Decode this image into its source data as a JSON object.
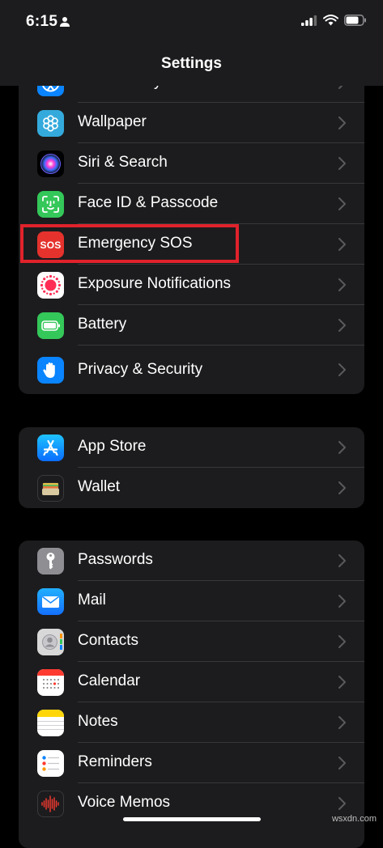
{
  "status_bar": {
    "time": "6:15"
  },
  "nav": {
    "title": "Settings"
  },
  "groups": [
    {
      "items": [
        {
          "label": "Accessibility",
          "icon": "accessibility-icon",
          "color": "#0a84ff"
        },
        {
          "label": "Wallpaper",
          "icon": "wallpaper-icon",
          "color": "#34aadc"
        },
        {
          "label": "Siri & Search",
          "icon": "siri-icon",
          "color": "#000000"
        },
        {
          "label": "Face ID & Passcode",
          "icon": "face-id-icon",
          "color": "#34c759"
        },
        {
          "label": "Emergency SOS",
          "icon": "sos-icon",
          "color": "#e5322d",
          "icon_text": "SOS",
          "highlighted": true
        },
        {
          "label": "Exposure Notifications",
          "icon": "exposure-notifications-icon",
          "color": "#ffffff"
        },
        {
          "label": "Battery",
          "icon": "battery-icon",
          "color": "#34c759"
        },
        {
          "label": "Privacy & Security",
          "icon": "privacy-hand-icon",
          "color": "#0a84ff"
        }
      ]
    },
    {
      "items": [
        {
          "label": "App Store",
          "icon": "app-store-icon",
          "color": "#1a8cff"
        },
        {
          "label": "Wallet",
          "icon": "wallet-icon",
          "color": "#1c1c1e"
        }
      ]
    },
    {
      "items": [
        {
          "label": "Passwords",
          "icon": "key-icon",
          "color": "#8e8e93"
        },
        {
          "label": "Mail",
          "icon": "mail-icon",
          "color": "#1a8cff"
        },
        {
          "label": "Contacts",
          "icon": "contacts-icon",
          "color": "#d8d8d8"
        },
        {
          "label": "Calendar",
          "icon": "calendar-icon",
          "color": "#ffffff"
        },
        {
          "label": "Notes",
          "icon": "notes-icon",
          "color": "#ffffff"
        },
        {
          "label": "Reminders",
          "icon": "reminders-icon",
          "color": "#ffffff"
        },
        {
          "label": "Voice Memos",
          "icon": "voice-memos-icon",
          "color": "#1c1c1e"
        }
      ]
    }
  ],
  "watermark": "wsxdn.com"
}
